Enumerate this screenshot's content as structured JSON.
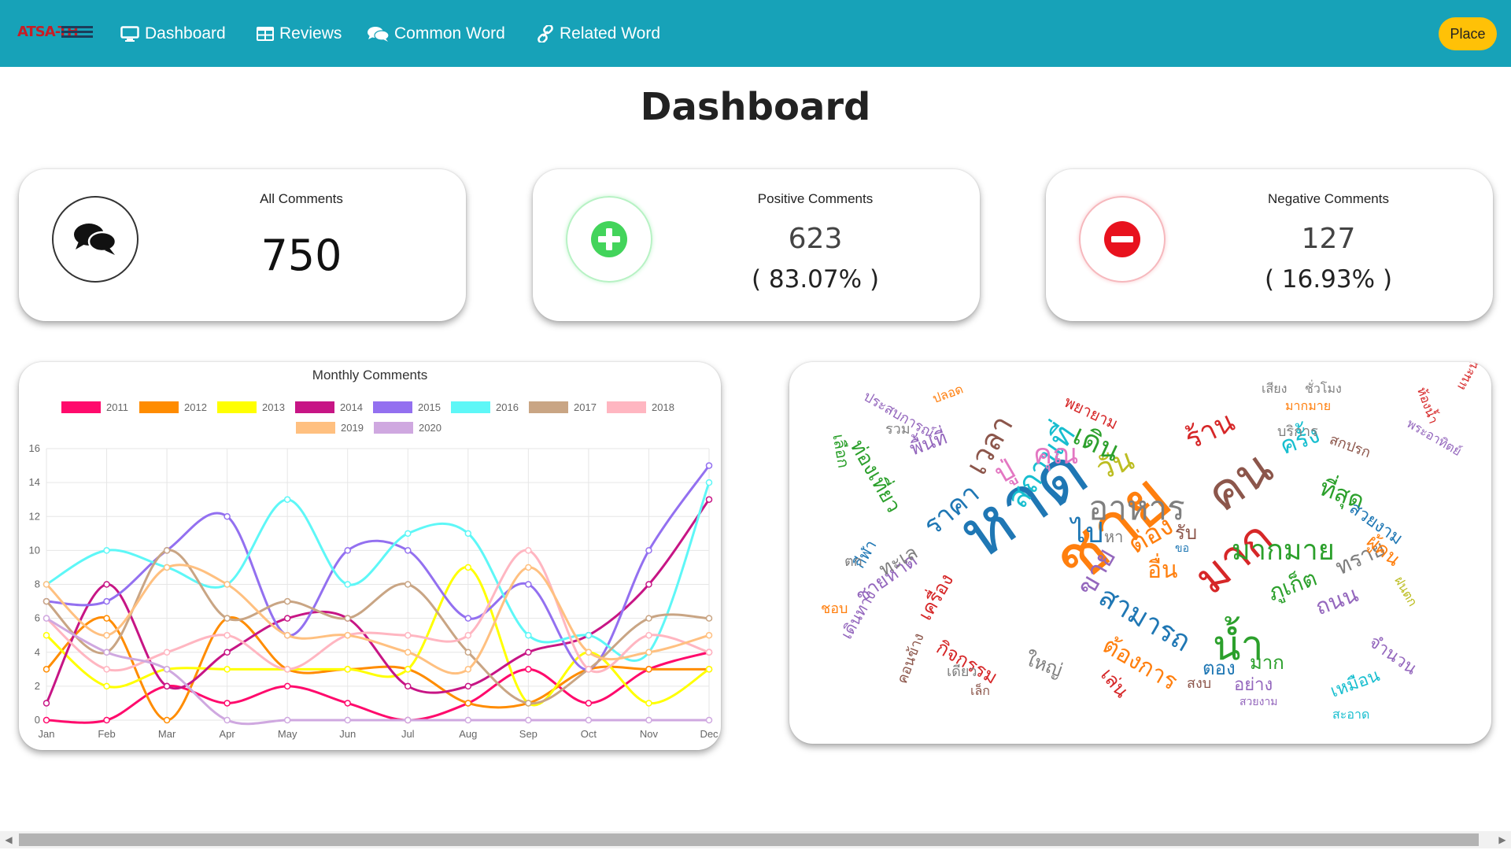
{
  "navbar": {
    "brand": "ATSA-TH",
    "items": [
      {
        "label": "Dashboard",
        "icon": "monitor-icon"
      },
      {
        "label": "Reviews",
        "icon": "table-icon"
      },
      {
        "label": "Common Word",
        "icon": "comments-icon"
      },
      {
        "label": "Related Word",
        "icon": "link-icon"
      }
    ],
    "place_label": "Place"
  },
  "page_title": "Dashboard",
  "cards": {
    "all": {
      "label": "All Comments",
      "value": "750",
      "icon": "comments-icon"
    },
    "positive": {
      "label": "Positive Comments",
      "value": "623",
      "pct": "( 83.07% )",
      "icon": "plus-circle-icon",
      "color": "#43d45b"
    },
    "negative": {
      "label": "Negative Comments",
      "value": "127",
      "pct": "( 16.93% )",
      "icon": "minus-circle-icon",
      "color": "#e8121e"
    }
  },
  "colors": {
    "navbar": "#17a2b8",
    "place_button": "#ffc107"
  },
  "chart_data": {
    "type": "line",
    "title": "Monthly Comments",
    "x": [
      "Jan",
      "Feb",
      "Mar",
      "Apr",
      "May",
      "Jun",
      "Jul",
      "Aug",
      "Sep",
      "Oct",
      "Nov",
      "Dec"
    ],
    "ylim": [
      0,
      16
    ],
    "yticks": [
      0,
      2,
      4,
      6,
      8,
      10,
      12,
      14,
      16
    ],
    "grid": true,
    "legend_position": "top",
    "series": [
      {
        "name": "2011",
        "color": "#ff0a6c",
        "values": [
          0,
          0,
          2,
          1,
          2,
          1,
          0,
          1,
          3,
          1,
          3,
          4
        ]
      },
      {
        "name": "2012",
        "color": "#ff8c00",
        "values": [
          3,
          6,
          0,
          6,
          3,
          3,
          3,
          1,
          1,
          3,
          3,
          3
        ]
      },
      {
        "name": "2013",
        "color": "#ffff00",
        "values": [
          5,
          2,
          3,
          3,
          3,
          3,
          3,
          9,
          1,
          4,
          1,
          3
        ]
      },
      {
        "name": "2014",
        "color": "#c71585",
        "values": [
          1,
          8,
          2,
          4,
          6,
          6,
          2,
          2,
          4,
          5,
          8,
          13
        ]
      },
      {
        "name": "2015",
        "color": "#9370f0",
        "values": [
          7,
          7,
          10,
          12,
          5,
          10,
          10,
          6,
          8,
          3,
          10,
          15
        ]
      },
      {
        "name": "2016",
        "color": "#5ef7f7",
        "values": [
          8,
          10,
          9,
          8,
          13,
          8,
          11,
          11,
          5,
          5,
          4,
          14
        ]
      },
      {
        "name": "2017",
        "color": "#c9a584",
        "values": [
          7,
          4,
          10,
          6,
          7,
          6,
          8,
          4,
          1,
          3,
          6,
          6
        ]
      },
      {
        "name": "2018",
        "color": "#ffb6c1",
        "values": [
          6,
          3,
          4,
          5,
          3,
          5,
          5,
          5,
          10,
          3,
          5,
          4
        ]
      },
      {
        "name": "2019",
        "color": "#ffc080",
        "values": [
          8,
          5,
          9,
          8,
          5,
          5,
          4,
          3,
          9,
          4,
          4,
          5
        ]
      },
      {
        "name": "2020",
        "color": "#cfa8e0",
        "values": [
          6,
          4,
          3,
          0,
          0,
          0,
          0,
          0,
          0,
          0,
          0,
          0
        ]
      }
    ]
  },
  "wordcloud": {
    "words": [
      {
        "t": "หาด",
        "s": 92,
        "c": "#1f77b4",
        "x": 200,
        "y": 190,
        "r": -35
      },
      {
        "t": "ชาย",
        "s": 88,
        "c": "#ff7f0e",
        "x": 320,
        "y": 230,
        "r": -40
      },
      {
        "t": "คน",
        "s": 62,
        "c": "#8c564b",
        "x": 520,
        "y": 150,
        "r": -35
      },
      {
        "t": "มาก",
        "s": 58,
        "c": "#d62728",
        "x": 505,
        "y": 260,
        "r": -40
      },
      {
        "t": "น้ำ",
        "s": 52,
        "c": "#2ca02c",
        "x": 538,
        "y": 335,
        "r": 0
      },
      {
        "t": "อาหาร",
        "s": 42,
        "c": "#7f7f7f",
        "x": 380,
        "y": 165,
        "r": 0
      },
      {
        "t": "มากมาย",
        "s": 36,
        "c": "#2ca02c",
        "x": 562,
        "y": 222,
        "r": 0
      },
      {
        "t": "สถานที่",
        "s": 38,
        "c": "#17becf",
        "x": 270,
        "y": 170,
        "r": -55
      },
      {
        "t": "สามารถ",
        "s": 36,
        "c": "#1f77b4",
        "x": 405,
        "y": 280,
        "r": 30
      },
      {
        "t": "ต้องการ",
        "s": 30,
        "c": "#ff7f0e",
        "x": 408,
        "y": 345,
        "r": 30
      },
      {
        "t": "เวลา",
        "s": 38,
        "c": "#8c564b",
        "x": 218,
        "y": 130,
        "r": -60
      },
      {
        "t": "ราคา",
        "s": 34,
        "c": "#1f77b4",
        "x": 165,
        "y": 200,
        "r": -40
      },
      {
        "t": "คุณ",
        "s": 36,
        "c": "#e377c2",
        "x": 310,
        "y": 100,
        "r": 0
      },
      {
        "t": "วัน",
        "s": 38,
        "c": "#bcbd22",
        "x": 385,
        "y": 120,
        "r": -20
      },
      {
        "t": "ไป",
        "s": 36,
        "c": "#1f77b4",
        "x": 358,
        "y": 200,
        "r": 0
      },
      {
        "t": "ร้าน",
        "s": 36,
        "c": "#d62728",
        "x": 498,
        "y": 85,
        "r": -25
      },
      {
        "t": "เดิน",
        "s": 36,
        "c": "#2ca02c",
        "x": 370,
        "y": 75,
        "r": 25
      },
      {
        "t": "ต่อง",
        "s": 34,
        "c": "#ff7f0e",
        "x": 425,
        "y": 220,
        "r": -30
      },
      {
        "t": "ขาย",
        "s": 34,
        "c": "#9467bd",
        "x": 360,
        "y": 285,
        "r": -60
      },
      {
        "t": "อื่น",
        "s": 30,
        "c": "#ff7f0e",
        "x": 455,
        "y": 250,
        "r": 0
      },
      {
        "t": "ปู่",
        "s": 36,
        "c": "#e377c2",
        "x": 255,
        "y": 130,
        "r": -30
      },
      {
        "t": "ที่สุด",
        "s": 30,
        "c": "#2ca02c",
        "x": 680,
        "y": 145,
        "r": 20
      },
      {
        "t": "ครั้ง",
        "s": 30,
        "c": "#17becf",
        "x": 620,
        "y": 95,
        "r": -20
      },
      {
        "t": "ทราย",
        "s": 28,
        "c": "#7f7f7f",
        "x": 690,
        "y": 250,
        "r": -25
      },
      {
        "t": "ถนน",
        "s": 28,
        "c": "#9467bd",
        "x": 665,
        "y": 300,
        "r": -20
      },
      {
        "t": "ภูเก็ต",
        "s": 28,
        "c": "#2ca02c",
        "x": 605,
        "y": 282,
        "r": -20
      },
      {
        "t": "มาก",
        "s": 24,
        "c": "#2ca02c",
        "x": 585,
        "y": 370,
        "r": 0
      },
      {
        "t": "ตอง",
        "s": 24,
        "c": "#1f77b4",
        "x": 525,
        "y": 377,
        "r": 0
      },
      {
        "t": "อย่าง",
        "s": 22,
        "c": "#9467bd",
        "x": 565,
        "y": 400,
        "r": 0
      },
      {
        "t": "ใหญ่",
        "s": 24,
        "c": "#7f7f7f",
        "x": 305,
        "y": 365,
        "r": 20
      },
      {
        "t": "เล่น",
        "s": 24,
        "c": "#d62728",
        "x": 410,
        "y": 385,
        "r": 50
      },
      {
        "t": "กิจกรรม",
        "s": 24,
        "c": "#d62728",
        "x": 195,
        "y": 350,
        "r": 30
      },
      {
        "t": "เครื่อง",
        "s": 24,
        "c": "#d62728",
        "x": 160,
        "y": 320,
        "r": -60
      },
      {
        "t": "ชายหาด",
        "s": 24,
        "c": "#9467bd",
        "x": 80,
        "y": 290,
        "r": -35
      },
      {
        "t": "ทะเล",
        "s": 24,
        "c": "#7f7f7f",
        "x": 110,
        "y": 255,
        "r": -30
      },
      {
        "t": "ท่องเที่ยว",
        "s": 26,
        "c": "#2ca02c",
        "x": 95,
        "y": 95,
        "r": 60
      },
      {
        "t": "พื้นที่",
        "s": 24,
        "c": "#9467bd",
        "x": 150,
        "y": 100,
        "r": -20
      },
      {
        "t": "ผู้คน",
        "s": 24,
        "c": "#ff7f0e",
        "x": 745,
        "y": 215,
        "r": 40
      },
      {
        "t": "สวยงาม",
        "s": 22,
        "c": "#1f77b4",
        "x": 720,
        "y": 175,
        "r": 35
      },
      {
        "t": "จำนวน",
        "s": 22,
        "c": "#9467bd",
        "x": 745,
        "y": 345,
        "r": 35
      },
      {
        "t": "เหมือน",
        "s": 22,
        "c": "#17becf",
        "x": 685,
        "y": 410,
        "r": -20
      },
      {
        "t": "บริการ",
        "s": 18,
        "c": "#7f7f7f",
        "x": 620,
        "y": 80,
        "r": 0
      },
      {
        "t": "สกปรก",
        "s": 18,
        "c": "#8c564b",
        "x": 690,
        "y": 90,
        "r": 20
      },
      {
        "t": "มากมาย",
        "s": 16,
        "c": "#ff7f0e",
        "x": 630,
        "y": 48,
        "r": 0
      },
      {
        "t": "เสียง",
        "s": 16,
        "c": "#7f7f7f",
        "x": 600,
        "y": 26,
        "r": 0
      },
      {
        "t": "ชั่วโมง",
        "s": 16,
        "c": "#7f7f7f",
        "x": 655,
        "y": 26,
        "r": 0
      },
      {
        "t": "พยายาม",
        "s": 20,
        "c": "#d62728",
        "x": 355,
        "y": 40,
        "r": 25
      },
      {
        "t": "ประสบการณ์",
        "s": 18,
        "c": "#9467bd",
        "x": 100,
        "y": 35,
        "r": 30
      },
      {
        "t": "ปลอด",
        "s": 16,
        "c": "#ff7f0e",
        "x": 180,
        "y": 40,
        "r": -20
      },
      {
        "t": "เลือก",
        "s": 20,
        "c": "#2ca02c",
        "x": 72,
        "y": 90,
        "r": 80
      },
      {
        "t": "รวม",
        "s": 18,
        "c": "#7f7f7f",
        "x": 122,
        "y": 77,
        "r": 0
      },
      {
        "t": "ชอบ",
        "s": 18,
        "c": "#ff7f0e",
        "x": 40,
        "y": 305,
        "r": 0
      },
      {
        "t": "กีฬา",
        "s": 20,
        "c": "#1f77b4",
        "x": 78,
        "y": 255,
        "r": -60
      },
      {
        "t": "ตก",
        "s": 18,
        "c": "#7f7f7f",
        "x": 70,
        "y": 245,
        "r": 0
      },
      {
        "t": "เดินทาง",
        "s": 20,
        "c": "#9467bd",
        "x": 62,
        "y": 345,
        "r": -60
      },
      {
        "t": "คอนข้าง",
        "s": 18,
        "c": "#8c564b",
        "x": 135,
        "y": 405,
        "r": -70
      },
      {
        "t": "เดียว",
        "s": 18,
        "c": "#7f7f7f",
        "x": 200,
        "y": 385,
        "r": 0
      },
      {
        "t": "เล็ก",
        "s": 16,
        "c": "#8c564b",
        "x": 230,
        "y": 410,
        "r": 0
      },
      {
        "t": "ขอ",
        "s": 14,
        "c": "#1f77b4",
        "x": 490,
        "y": 230,
        "r": 0
      },
      {
        "t": "รับ",
        "s": 24,
        "c": "#8c564b",
        "x": 490,
        "y": 205,
        "r": 0
      },
      {
        "t": "หา",
        "s": 20,
        "c": "#7f7f7f",
        "x": 400,
        "y": 212,
        "r": 0
      },
      {
        "t": "สงบ",
        "s": 18,
        "c": "#8c564b",
        "x": 505,
        "y": 400,
        "r": 0
      },
      {
        "t": "สวยงาม",
        "s": 14,
        "c": "#9467bd",
        "x": 572,
        "y": 425,
        "r": 0
      },
      {
        "t": "สะอาด",
        "s": 16,
        "c": "#17becf",
        "x": 690,
        "y": 440,
        "r": 0
      },
      {
        "t": "พระอาทิตย์",
        "s": 16,
        "c": "#9467bd",
        "x": 790,
        "y": 70,
        "r": 30
      },
      {
        "t": "ห้องน้ำ",
        "s": 16,
        "c": "#d62728",
        "x": 810,
        "y": 30,
        "r": 70
      },
      {
        "t": "แนะนำ",
        "s": 16,
        "c": "#d62728",
        "x": 845,
        "y": 30,
        "r": -60
      },
      {
        "t": "ฝนตก",
        "s": 16,
        "c": "#bcbd22",
        "x": 780,
        "y": 270,
        "r": 60
      }
    ]
  },
  "scrollbar": {
    "left_arrow": "◀",
    "right_arrow": "▶"
  }
}
